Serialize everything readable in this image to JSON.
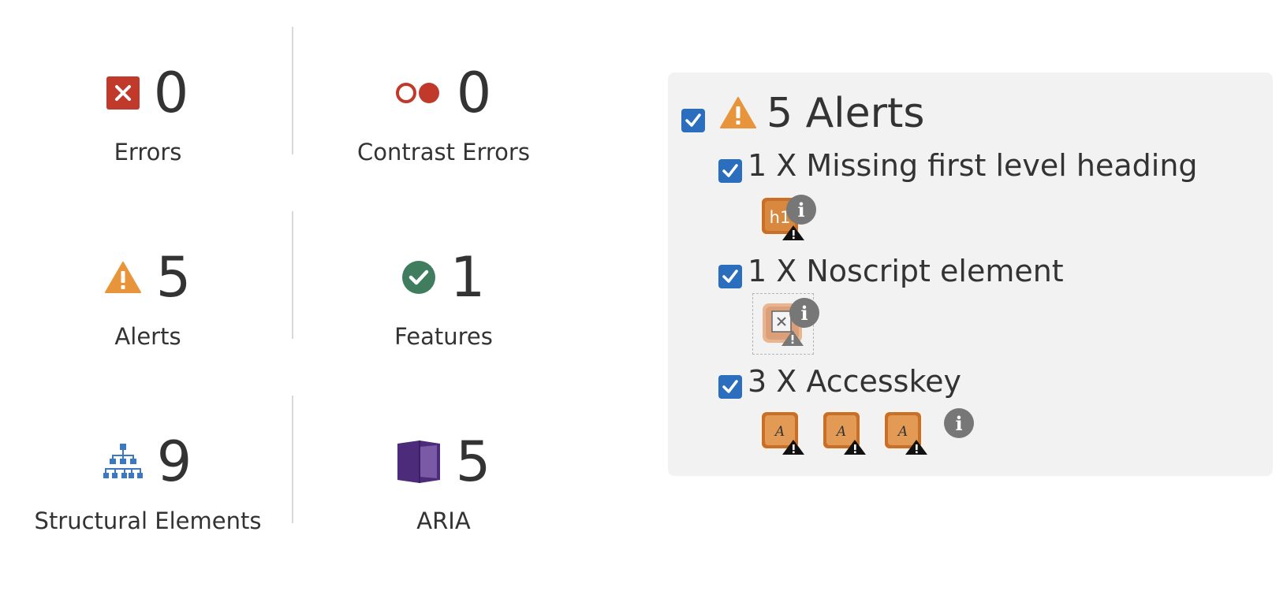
{
  "summary": {
    "errors": {
      "count": "0",
      "label": "Errors",
      "icon": "error-x-icon",
      "color": "#c0392b"
    },
    "contrast_errors": {
      "count": "0",
      "label": "Contrast Errors",
      "icon": "contrast-icon",
      "color": "#c0392b"
    },
    "alerts": {
      "count": "5",
      "label": "Alerts",
      "icon": "warning-triangle-icon",
      "color": "#e8943a"
    },
    "features": {
      "count": "1",
      "label": "Features",
      "icon": "check-circle-icon",
      "color": "#3f7d5e"
    },
    "structural": {
      "count": "9",
      "label": "Structural Elements",
      "icon": "hierarchy-icon",
      "color": "#3b78c2"
    },
    "aria": {
      "count": "5",
      "label": "ARIA",
      "icon": "aria-cube-icon",
      "color": "#4b2b7a"
    }
  },
  "alerts_panel": {
    "title": "5 Alerts",
    "checked": true,
    "items": [
      {
        "label": "1 X Missing first level heading",
        "checked": true,
        "thumbs": [
          "h1"
        ]
      },
      {
        "label": "1 X Noscript element",
        "checked": true,
        "thumbs": [
          "noscript"
        ]
      },
      {
        "label": "3 X Accesskey",
        "checked": true,
        "thumbs": [
          "A",
          "A",
          "A"
        ]
      }
    ],
    "info_glyph": "i"
  },
  "colors": {
    "checkbox": "#2a6ebd",
    "panel_bg": "#f2f2f2",
    "alert_orange": "#c8702a",
    "text": "#333333"
  }
}
